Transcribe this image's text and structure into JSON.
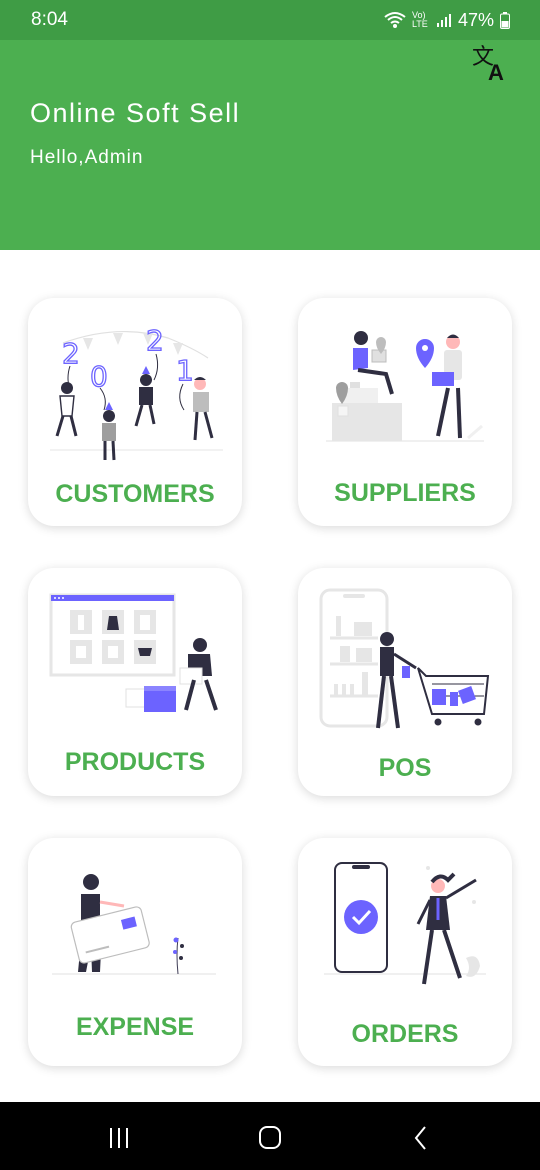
{
  "status_bar": {
    "time": "8:04",
    "network": "Vo) LTE",
    "battery": "47%"
  },
  "header": {
    "app_title": "Online Soft Sell",
    "greeting": "Hello,Admin",
    "translate_icon": "translate-icon",
    "bg_color": "#4caf50"
  },
  "cards": [
    {
      "id": "customers",
      "label": "CUSTOMERS"
    },
    {
      "id": "suppliers",
      "label": "SUPPLIERS"
    },
    {
      "id": "products",
      "label": "PRODUCTS"
    },
    {
      "id": "pos",
      "label": "POS"
    },
    {
      "id": "expense",
      "label": "EXPENSE"
    },
    {
      "id": "orders",
      "label": "ORDERS"
    }
  ],
  "nav": {
    "recents_icon": "recents-icon",
    "home_icon": "home-icon",
    "back_icon": "back-icon"
  },
  "colors": {
    "accent": "#4caf50",
    "illustration_purple": "#6c63ff",
    "dark": "#2f2e41"
  }
}
